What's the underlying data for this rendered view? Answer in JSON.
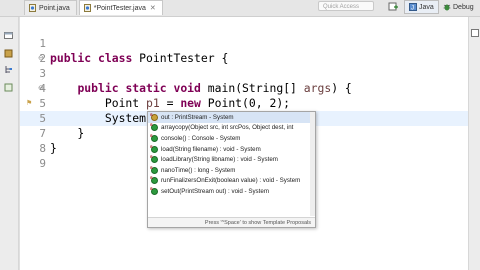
{
  "toolbar": {
    "quick_access_placeholder": "Quick Access",
    "perspectives": [
      {
        "label": "Java",
        "active": true
      },
      {
        "label": "Debug",
        "active": false
      }
    ]
  },
  "tabs": [
    {
      "label": "Point.java",
      "active": false
    },
    {
      "label": "*PointTester.java",
      "active": true
    }
  ],
  "editor": {
    "lines": [
      {
        "n": "1",
        "text": ""
      },
      {
        "n": "2",
        "text": "public class PointTester {"
      },
      {
        "n": "3",
        "text": ""
      },
      {
        "n": "4",
        "text": "    public static void main(String[] args) {"
      },
      {
        "n": "5",
        "text": "        Point p1 = new Point(0, 2);"
      },
      {
        "n": "5",
        "text": "        System.ou"
      },
      {
        "n": "7",
        "text": "    }"
      },
      {
        "n": "8",
        "text": "}"
      },
      {
        "n": "9",
        "text": ""
      }
    ]
  },
  "autocomplete": {
    "items": [
      "out : PrintStream - System",
      "arraycopy(Object src, int srcPos, Object dest, int",
      "console() : Console - System",
      "load(String filename) : void - System",
      "loadLibrary(String libname) : void - System",
      "nanoTime() : long - System",
      "runFinalizersOnExit(boolean value) : void - System",
      "setOut(PrintStream out) : void - System"
    ],
    "footer": "Press '^Space' to show Template Proposals"
  },
  "colors": {
    "keyword": "#7f0055",
    "variable": "#6a3e3e",
    "current_line": "#e8f2fe"
  }
}
